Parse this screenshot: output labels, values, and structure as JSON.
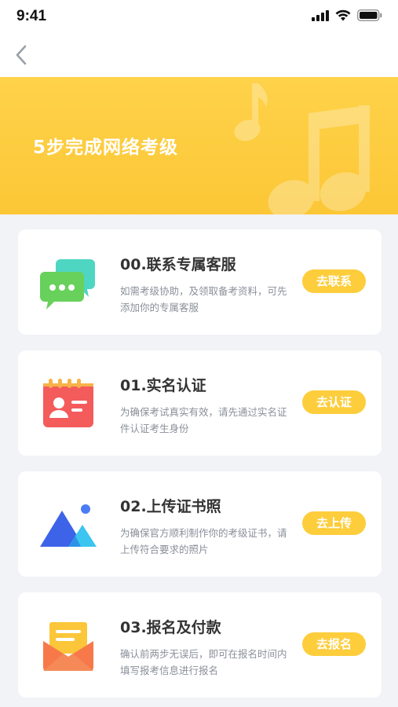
{
  "status_bar": {
    "time": "9:41"
  },
  "banner": {
    "title": "5步完成网络考级"
  },
  "steps": [
    {
      "title": "00.联系专属客服",
      "desc": "如需考级协助，及领取备考资料，可先添加你的专属客服",
      "button": "去联系",
      "icon": "chat-bubble-icon"
    },
    {
      "title": "01.实名认证",
      "desc": "为确保考试真实有效，请先通过实名证件认证考生身份",
      "button": "去认证",
      "icon": "id-card-icon"
    },
    {
      "title": "02.上传证书照",
      "desc": "为确保官方顺利制作你的考级证书，请上传符合要求的照片",
      "button": "去上传",
      "icon": "image-mountain-icon"
    },
    {
      "title": "03.报名及付款",
      "desc": "确认前两步无误后，即可在报名时间内填写报考信息进行报名",
      "button": "去报名",
      "icon": "envelope-icon"
    }
  ],
  "colors": {
    "accent": "#fdcd3c",
    "banner_top": "#fed24a",
    "background": "#f1f3f6"
  }
}
